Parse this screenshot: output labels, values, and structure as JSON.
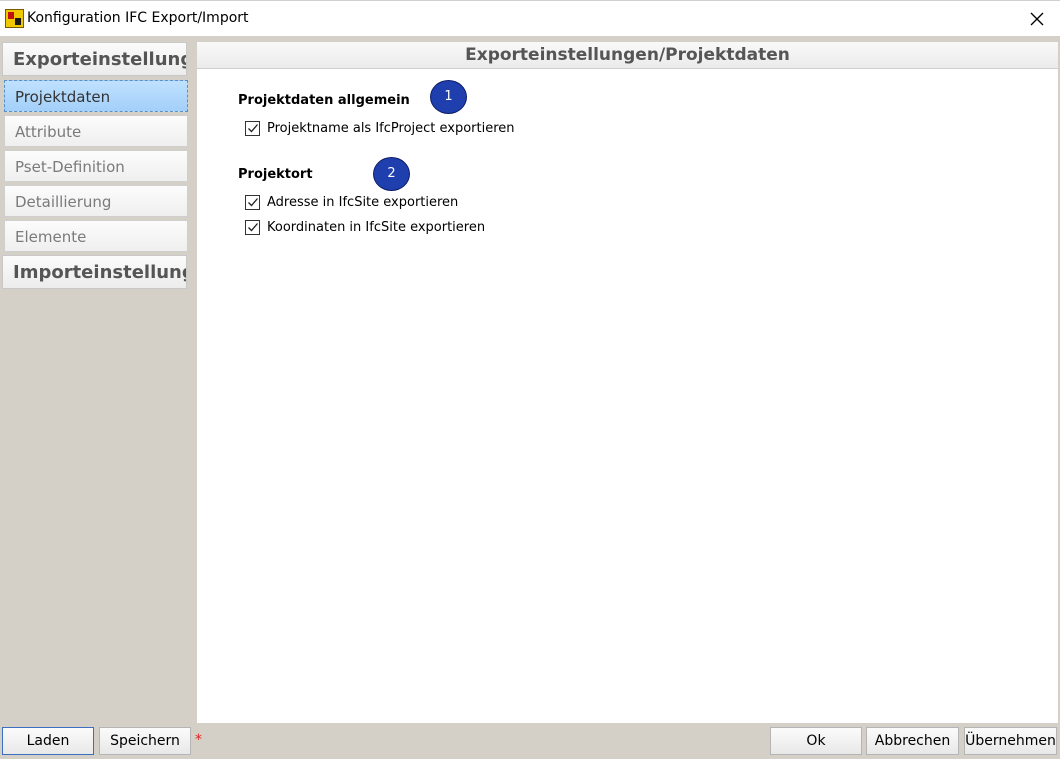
{
  "window": {
    "title": "Konfiguration IFC Export/Import",
    "app_icon": "app-logo-icon",
    "close_icon": "close-icon"
  },
  "sidebar": {
    "export_header": "Exporteinstellungen",
    "items": [
      {
        "label": "Projektdaten",
        "selected": true
      },
      {
        "label": "Attribute",
        "selected": false
      },
      {
        "label": "Pset-Definition",
        "selected": false
      },
      {
        "label": "Detaillierung",
        "selected": false
      },
      {
        "label": "Elemente",
        "selected": false
      }
    ],
    "import_header": "Importeinstellungen"
  },
  "content": {
    "header": "Exporteinstellungen/Projektdaten",
    "sections": [
      {
        "title": "Projektdaten allgemein",
        "badge": "1",
        "options": [
          {
            "label": "Projektname als IfcProject exportieren",
            "checked": true
          }
        ]
      },
      {
        "title": "Projektort",
        "badge": "2",
        "options": [
          {
            "label": "Adresse in IfcSite exportieren",
            "checked": true
          },
          {
            "label": "Koordinaten in IfcSite exportieren",
            "checked": true
          }
        ]
      }
    ]
  },
  "footer": {
    "load_label": "Laden",
    "save_label": "Speichern",
    "unsaved_marker": "*",
    "ok_label": "Ok",
    "cancel_label": "Abbrechen",
    "apply_label": "Übernehmen"
  },
  "colors": {
    "dialog_bg": "#d4d0c8",
    "selected_item": "#a3cff9",
    "badge": "#1f3fae",
    "unsaved_marker": "#e02020"
  }
}
